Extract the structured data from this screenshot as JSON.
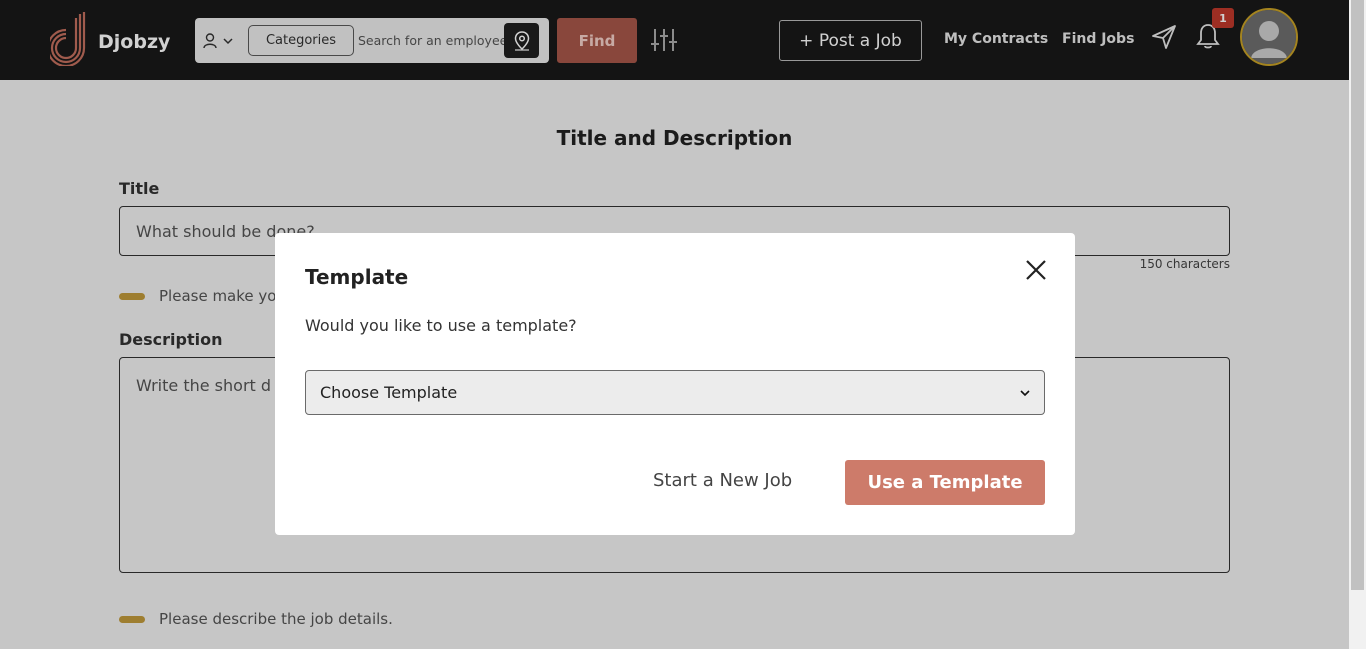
{
  "brand": {
    "name": "Djobzy"
  },
  "header": {
    "categories_label": "Categories",
    "search_placeholder": "Search for an employee",
    "find_label": "Find",
    "post_job_label": "+ Post a Job",
    "nav": {
      "my_contracts": "My Contracts",
      "find_jobs": "Find Jobs"
    },
    "notification_count": "1",
    "icons": [
      "user-icon",
      "chevron-down-icon",
      "location-pin-icon",
      "filter-sliders-icon",
      "send-icon",
      "bell-icon",
      "avatar"
    ]
  },
  "page": {
    "section_title": "Title and Description",
    "title_label": "Title",
    "title_placeholder": "What should be done?",
    "title_char_limit": "150 characters",
    "title_hint": "Please make yo",
    "description_label": "Description",
    "description_placeholder": "Write the short d",
    "description_hint": "Please describe the job details."
  },
  "modal": {
    "title": "Template",
    "question": "Would you like to use a template?",
    "select_value": "Choose Template",
    "secondary_button": "Start a New Job",
    "primary_button": "Use a Template"
  },
  "colors": {
    "topbar_bg": "#191919",
    "find_button": "#a8574a",
    "primary_button": "#cd7b6a",
    "hint_pill": "#c19a3b",
    "badge": "#c0392b",
    "avatar_ring": "#c9a227"
  }
}
